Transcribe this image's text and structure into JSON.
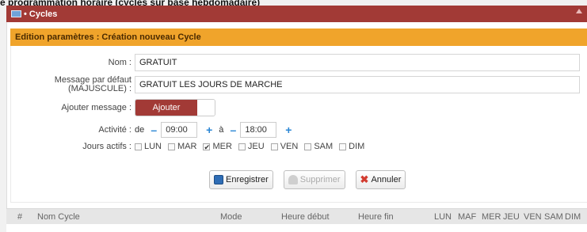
{
  "page_heading": "e programmation horaire (cycles sur base hebdomadaire)",
  "window": {
    "title": "Cycles"
  },
  "section": {
    "title": "Edition paramètres : Création nouveau Cycle"
  },
  "form": {
    "nom": {
      "label": "Nom :",
      "value": "GRATUIT"
    },
    "message": {
      "label_line1": "Message par défaut",
      "label_line2": "(MAJUSCULE) :",
      "value": "GRATUIT LES JOURS DE MARCHE"
    },
    "ajouter": {
      "label": "Ajouter message :",
      "toggle_label": "Ajouter"
    },
    "activite": {
      "label": "Activité :",
      "from_prefix": "de",
      "from": "09:00",
      "to_prefix": "à",
      "to": "18:00",
      "minus": "–",
      "plus": "+"
    },
    "jours": {
      "label": "Jours actifs :",
      "days": [
        {
          "label": "LUN",
          "checked": false
        },
        {
          "label": "MAR",
          "checked": false
        },
        {
          "label": "MER",
          "checked": true
        },
        {
          "label": "JEU",
          "checked": false
        },
        {
          "label": "VEN",
          "checked": false
        },
        {
          "label": "SAM",
          "checked": false
        },
        {
          "label": "DIM",
          "checked": false
        }
      ]
    }
  },
  "actions": {
    "save": "Enregistrer",
    "delete": "Supprimer",
    "cancel": "Annuler"
  },
  "table": {
    "columns": [
      "#",
      "Nom Cycle",
      "Mode",
      "Heure début",
      "Heure fin",
      "LUN",
      "MAF",
      "MER",
      "JEU",
      "VEN",
      "SAM",
      "DIM"
    ]
  },
  "colors": {
    "titlebar": "#a23a36",
    "section_bar": "#f0a42b",
    "accent": "#2a86d4"
  }
}
